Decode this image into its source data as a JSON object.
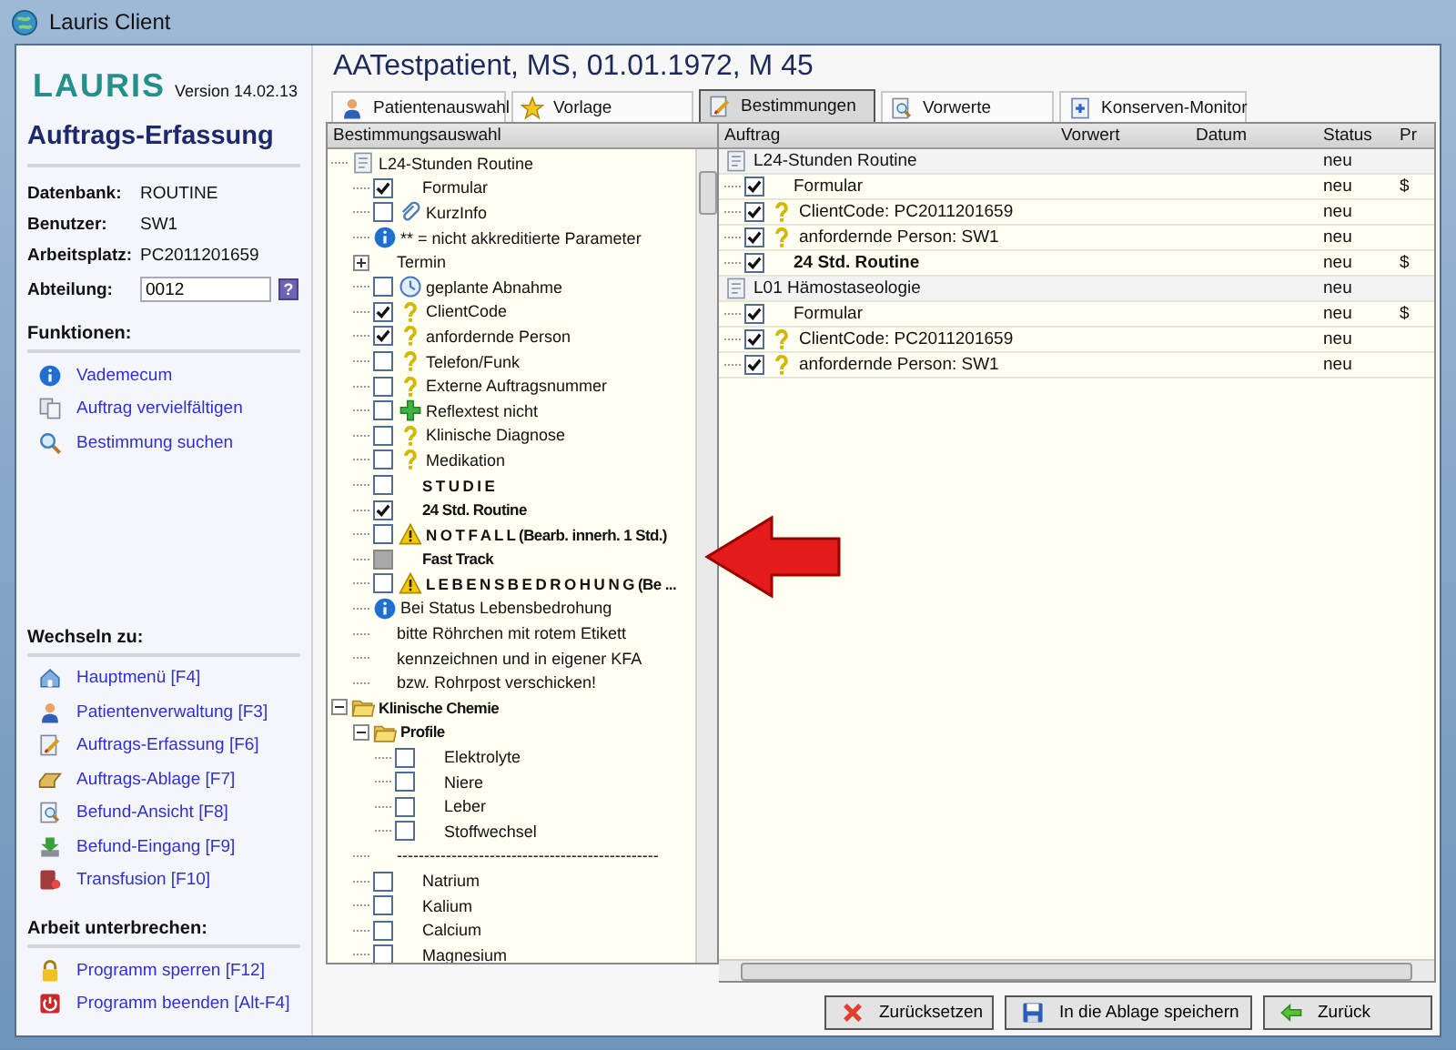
{
  "window": {
    "title": "Lauris Client"
  },
  "sidebar": {
    "logo": "LAURIS",
    "version": "Version 14.02.13",
    "module": "Auftrags-Erfassung",
    "info": [
      {
        "label": "Datenbank:",
        "value": "ROUTINE"
      },
      {
        "label": "Benutzer:",
        "value": "SW1"
      },
      {
        "label": "Arbeitsplatz:",
        "value": "PC2011201659"
      }
    ],
    "department": {
      "label": "Abteilung:",
      "value": "0012",
      "help": "?"
    },
    "sections": [
      {
        "title": "Funktionen:",
        "links": [
          "Vademecum",
          "Auftrag vervielfältigen",
          "Bestimmung suchen"
        ]
      },
      {
        "title": "Wechseln zu:",
        "links": [
          "Hauptmenü [F4]",
          "Patientenverwaltung [F3]",
          "Auftrags-Erfassung [F6]",
          "Auftrags-Ablage [F7]",
          "Befund-Ansicht [F8]",
          "Befund-Eingang [F9]",
          "Transfusion [F10]"
        ]
      },
      {
        "title": "Arbeit unterbrechen:",
        "links": [
          "Programm sperren [F12]",
          "Programm beenden [Alt-F4]"
        ]
      }
    ]
  },
  "patient": "AATestpatient, MS, 01.01.1972, M 45",
  "tabs": [
    {
      "label": "Patientenauswahl",
      "selected": false
    },
    {
      "label": "Vorlage",
      "selected": false
    },
    {
      "label": "Bestimmungen",
      "selected": true
    },
    {
      "label": "Vorwerte",
      "selected": false
    },
    {
      "label": "Konserven-Monitor",
      "selected": false
    }
  ],
  "selection_tree": {
    "title": "Bestimmungsauswahl",
    "items": [
      {
        "kind": "form",
        "label": "L24-Stunden Routine",
        "children": [
          {
            "kind": "plain",
            "label": "Formular",
            "checked": true
          },
          {
            "kind": "paperclip",
            "label": "KurzInfo",
            "checked": false
          },
          {
            "kind": "info",
            "label": "** = nicht akkreditierte Parameter"
          },
          {
            "kind": "plain",
            "label": "Termin",
            "expanded": false
          },
          {
            "kind": "clock",
            "label": "geplante Abnahme",
            "checked": false
          },
          {
            "kind": "question",
            "label": "ClientCode",
            "checked": true
          },
          {
            "kind": "question",
            "label": "anfordernde Person",
            "checked": true
          },
          {
            "kind": "question",
            "label": "Telefon/Funk",
            "checked": false
          },
          {
            "kind": "question",
            "label": "Externe Auftragsnummer",
            "checked": false
          },
          {
            "kind": "plus",
            "label": "Reflextest nicht",
            "checked": false
          },
          {
            "kind": "question",
            "label": "Klinische Diagnose",
            "checked": false
          },
          {
            "kind": "question",
            "label": "Medikation",
            "checked": false
          },
          {
            "kind": "plain",
            "label": "S T U D I E",
            "checked": false,
            "bold": true
          },
          {
            "kind": "plain",
            "label": "24 Std. Routine",
            "checked": true,
            "bold": true
          },
          {
            "kind": "warning",
            "label": "N O T F A L L (Bearb. innerh.  1 Std.)",
            "checked": false,
            "bold": true
          },
          {
            "kind": "plain",
            "label": "Fast Track",
            "checked": false,
            "disabled": true,
            "bold": true
          },
          {
            "kind": "warning",
            "label": "L E B E N S B E D R O H U N G (Be ...",
            "checked": false,
            "bold": true
          },
          {
            "kind": "info",
            "label": "Bei Status Lebensbedrohung"
          },
          {
            "kind": "plain",
            "label": "bitte Röhrchen mit rotem Etikett"
          },
          {
            "kind": "plain",
            "label": "kennzeichnen und in eigener KFA"
          },
          {
            "kind": "plain",
            "label": "bzw. Rohrpost verschicken!"
          }
        ]
      },
      {
        "kind": "folder",
        "label": "Klinische Chemie",
        "bold": true,
        "expanded": true,
        "children": [
          {
            "kind": "folder",
            "label": "Profile",
            "bold": true,
            "expanded": true,
            "children": [
              {
                "kind": "plain",
                "label": "Elektrolyte",
                "checked": false
              },
              {
                "kind": "plain",
                "label": "Niere",
                "checked": false
              },
              {
                "kind": "plain",
                "label": "Leber",
                "checked": false
              },
              {
                "kind": "plain",
                "label": "Stoffwechsel",
                "checked": false
              }
            ]
          },
          {
            "kind": "plain",
            "label": "------------------------------------------------"
          },
          {
            "kind": "plain",
            "label": "Natrium",
            "checked": false
          },
          {
            "kind": "plain",
            "label": "Kalium",
            "checked": false
          },
          {
            "kind": "plain",
            "label": "Calcium",
            "checked": false
          },
          {
            "kind": "plain",
            "label": "Magnesium",
            "checked": false
          }
        ]
      }
    ]
  },
  "order_table": {
    "columns": [
      "Auftrag",
      "Vorwert",
      "Datum",
      "Status",
      "Pr"
    ],
    "groups": [
      {
        "label": "L24-Stunden Routine",
        "status": "neu",
        "rows": [
          {
            "kind": "plain",
            "label": "Formular",
            "checked": true,
            "status": "neu",
            "pr": "$"
          },
          {
            "kind": "question",
            "label": "ClientCode: PC2011201659",
            "checked": true,
            "status": "neu"
          },
          {
            "kind": "question",
            "label": "anfordernde Person: SW1",
            "checked": true,
            "status": "neu"
          },
          {
            "kind": "plain",
            "label": "24 Std. Routine",
            "checked": true,
            "bold": true,
            "status": "neu",
            "pr": "$"
          }
        ]
      },
      {
        "label": "L01 Hämostaseologie",
        "status": "neu",
        "rows": [
          {
            "kind": "plain",
            "label": "Formular",
            "checked": true,
            "status": "neu",
            "pr": "$"
          },
          {
            "kind": "question",
            "label": "ClientCode: PC2011201659",
            "checked": true,
            "status": "neu"
          },
          {
            "kind": "question",
            "label": "anfordernde Person: SW1",
            "checked": true,
            "status": "neu"
          }
        ]
      }
    ]
  },
  "buttons": [
    "Zurücksetzen",
    "In die Ablage speichern",
    "Zurück"
  ]
}
